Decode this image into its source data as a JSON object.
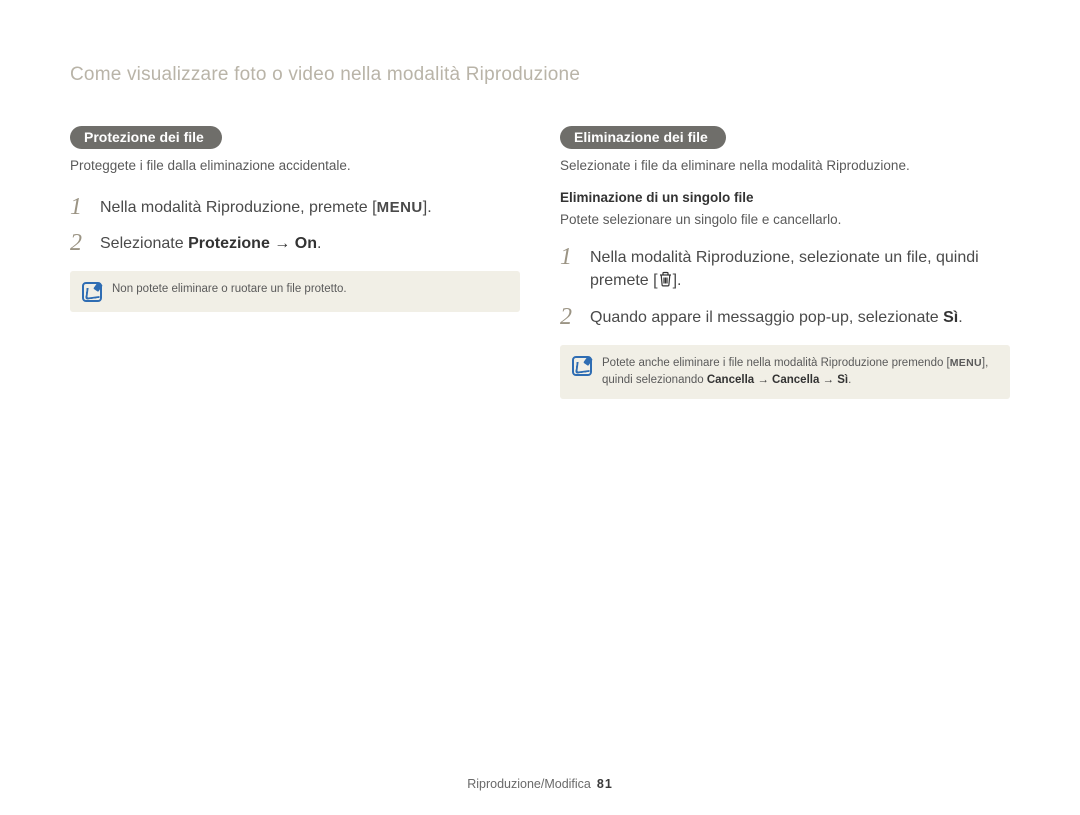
{
  "page_heading": "Come visualizzare foto o video nella modalità Riproduzione",
  "left": {
    "title": "Protezione dei file",
    "intro": "Proteggete i file dalla eliminazione accidentale.",
    "step1_prefix": "Nella modalità Riproduzione, premete [",
    "step1_menu": "MENU",
    "step1_suffix": "].",
    "step2_prefix": "Selezionate ",
    "step2_bold": "Protezione → On",
    "step2_suffix": ".",
    "note": "Non potete eliminare o ruotare un file protetto."
  },
  "right": {
    "title": "Eliminazione dei file",
    "intro": "Selezionate i file da eliminare nella modalità Riproduzione.",
    "subheading": "Eliminazione di un singolo file",
    "subtext": "Potete selezionare un singolo file e cancellarlo.",
    "step1_line1": "Nella modalità Riproduzione, selezionate un file, quindi",
    "step1_line2_prefix": "premete [",
    "step1_line2_suffix": "].",
    "step2_prefix": "Quando appare il messaggio pop-up, selezionate ",
    "step2_bold": "Sì",
    "step2_suffix": ".",
    "note_prefix": "Potete anche eliminare i file nella modalità Riproduzione premendo [",
    "note_menu": "MENU",
    "note_mid": "], quindi selezionando ",
    "note_bold": "Cancella → Cancella → Sì",
    "note_suffix": "."
  },
  "footer": {
    "section": "Riproduzione/Modifica",
    "page_number": "81"
  }
}
